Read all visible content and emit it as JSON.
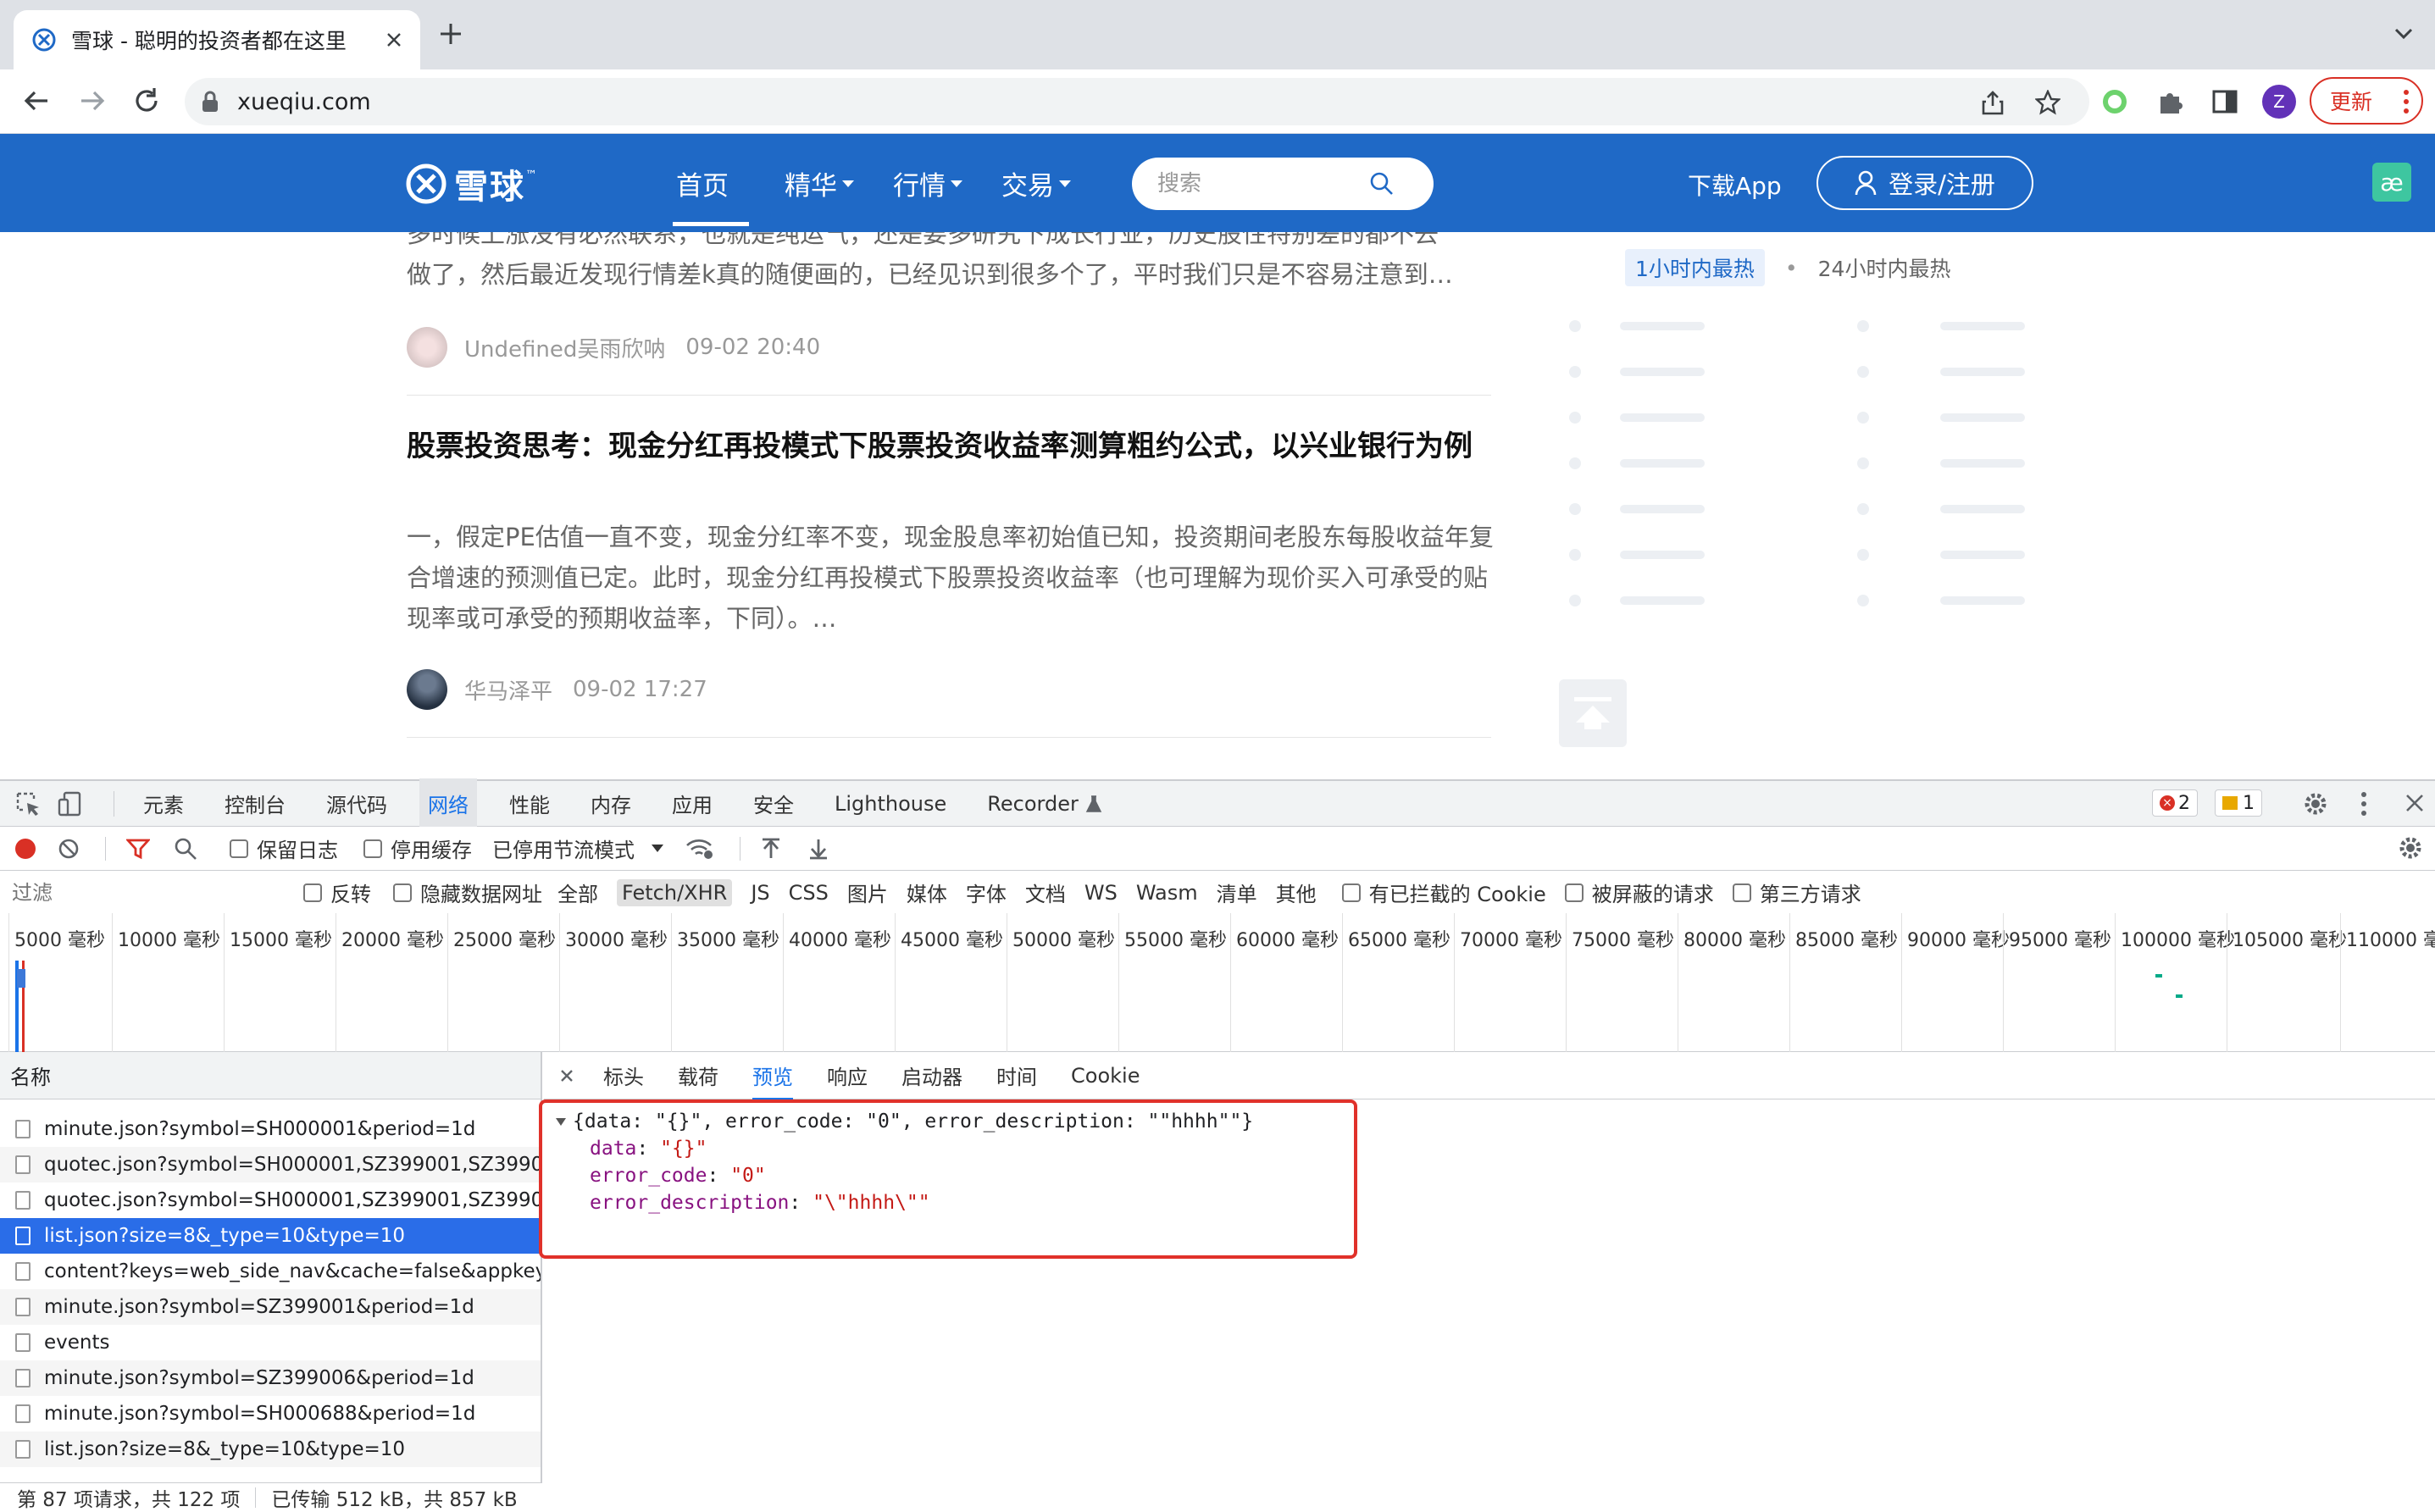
{
  "browser": {
    "tab_title": "雪球 - 聪明的投资者都在这里",
    "url": "xueqiu.com",
    "update_label": "更新",
    "profile_initial": "Z"
  },
  "site": {
    "logo_text": "雪球",
    "nav": [
      {
        "label": "首页"
      },
      {
        "label": "精华"
      },
      {
        "label": "行情"
      },
      {
        "label": "交易"
      }
    ],
    "search_placeholder": "搜索",
    "download_app": "下载App",
    "login_label": "登录/注册"
  },
  "feed": {
    "article1": {
      "excerpt_line1": "多时候上涨没有必然联系，也就是纯运气，还是要多研究下成长行业，历史股性特别差的都不去",
      "excerpt_line2": "做了，然后最近发现行情差k真的随便画的，已经见识到很多个了，平时我们只是不容易注意到…",
      "author": "Undefined吴雨欣呐",
      "time": "09-02 20:40"
    },
    "article2": {
      "title": "股票投资思考：现金分红再投模式下股票投资收益率测算粗约公式，以兴业银行为例",
      "excerpt": "一，假定PE估值一直不变，现金分红率不变，现金股息率初始值已知，投资期间老股东每股收益年复合增速的预测值已定。此时，现金分红再投模式下股票投资收益率（也可理解为现价买入可承受的贴现率或可承受的预期收益率，下同）。…",
      "author": "华马泽平",
      "time": "09-02 17:27"
    },
    "hot_tabs": [
      "1小时内最热",
      "24小时内最热"
    ]
  },
  "devtools": {
    "tabs": [
      "元素",
      "控制台",
      "源代码",
      "网络",
      "性能",
      "内存",
      "应用",
      "安全",
      "Lighthouse",
      "Recorder"
    ],
    "active_tab": "网络",
    "error_count": "2",
    "warning_count": "1",
    "toolbar": {
      "preserve_log": "保留日志",
      "disable_cache": "停用缓存",
      "throttling": "已停用节流模式"
    },
    "filter": {
      "placeholder": "过滤",
      "invert": "反转",
      "hide_data_urls": "隐藏数据网址",
      "types": [
        "全部",
        "Fetch/XHR",
        "JS",
        "CSS",
        "图片",
        "媒体",
        "字体",
        "文档",
        "WS",
        "Wasm",
        "清单",
        "其他"
      ],
      "selected_type": "Fetch/XHR",
      "blocked_cookies": "有已拦截的 Cookie",
      "blocked_requests": "被屏蔽的请求",
      "third_party": "第三方请求"
    },
    "timeline_ticks": [
      "5000 毫秒",
      "10000 毫秒",
      "15000 毫秒",
      "20000 毫秒",
      "25000 毫秒",
      "30000 毫秒",
      "35000 毫秒",
      "40000 毫秒",
      "45000 毫秒",
      "50000 毫秒",
      "55000 毫秒",
      "60000 毫秒",
      "65000 毫秒",
      "70000 毫秒",
      "75000 毫秒",
      "80000 毫秒",
      "85000 毫秒",
      "90000 毫秒",
      "95000 毫秒",
      "100000 毫秒",
      "105000 毫秒",
      "110000 毫秒"
    ],
    "list_header": "名称",
    "requests": [
      {
        "name": "minute.json?symbol=SH000001&period=1d",
        "selected": false
      },
      {
        "name": "quotec.json?symbol=SH000001,SZ399001,SZ3990...",
        "selected": false
      },
      {
        "name": "quotec.json?symbol=SH000001,SZ399001,SZ3990...",
        "selected": false
      },
      {
        "name": "list.json?size=8&_type=10&type=10",
        "selected": true
      },
      {
        "name": "content?keys=web_side_nav&cache=false&appkey...",
        "selected": false
      },
      {
        "name": "minute.json?symbol=SZ399001&period=1d",
        "selected": false
      },
      {
        "name": "events",
        "selected": false
      },
      {
        "name": "minute.json?symbol=SZ399006&period=1d",
        "selected": false
      },
      {
        "name": "minute.json?symbol=SH000688&period=1d",
        "selected": false
      },
      {
        "name": "list.json?size=8&_type=10&type=10",
        "selected": false
      }
    ],
    "status": {
      "requests": "第 87 项请求，共 122 项",
      "transferred": "已传输 512 kB，共 857 kB"
    },
    "detail_tabs": [
      "标头",
      "载荷",
      "预览",
      "响应",
      "启动器",
      "时间",
      "Cookie"
    ],
    "active_detail_tab": "预览",
    "preview": {
      "summary": "{data: \"{}\", error_code: \"0\", error_description: \"\"hhhh\"\"}",
      "fields": [
        {
          "key": "data",
          "value": "\"{}\""
        },
        {
          "key": "error_code",
          "value": "\"0\""
        },
        {
          "key": "error_description",
          "value": "\"\\\"hhhh\\\"\""
        }
      ]
    }
  }
}
